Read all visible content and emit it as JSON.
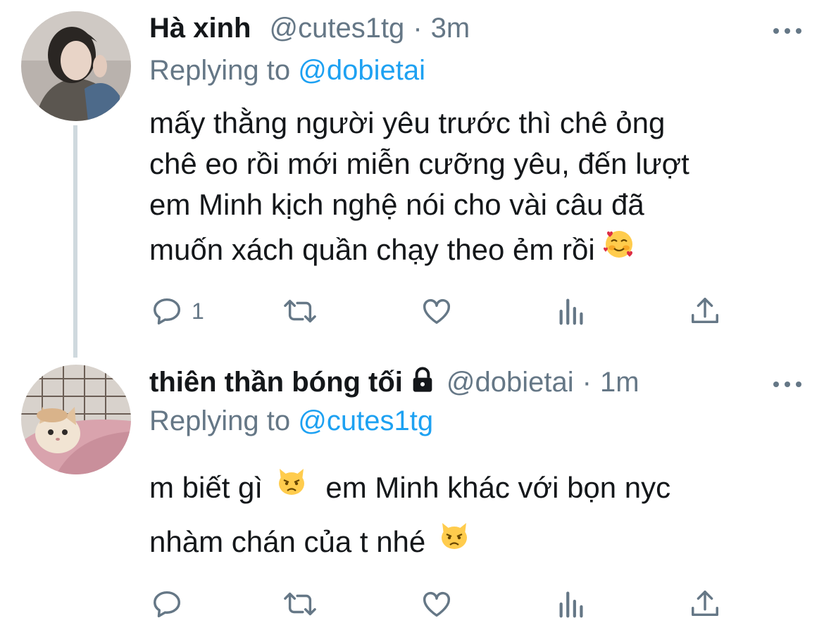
{
  "tweets": [
    {
      "name": "Hà xinh",
      "handle": "@cutes1tg",
      "dot": "·",
      "time": "3m",
      "replying_label": "Replying to",
      "replying_to": "@dobietai",
      "body_lines": [
        "mấy thằng người yêu trước thì chê ỏng",
        "chê eo rồi mới miễn cưỡng yêu, đến lượt",
        "em Minh kịch nghệ nói cho vài câu đã",
        "muốn xách quần chạy theo ẻm rồi"
      ],
      "body_emoji": "smiling-face-with-hearts",
      "reply_count": "1",
      "locked": false,
      "avatar": "person-photo"
    },
    {
      "name": "thiên thần bóng tối",
      "handle": "@dobietai",
      "dot": "·",
      "time": "1m",
      "replying_label": "Replying to",
      "replying_to": "@cutes1tg",
      "body_lines": [
        "m biết gì",
        "em Minh khác với bọn nyc",
        "nhàm chán của t nhé"
      ],
      "body_emoji": "pouting-cat",
      "reply_count": "",
      "locked": true,
      "avatar": "kitten-photo"
    }
  ],
  "colors": {
    "text": "#14171a",
    "secondary": "#657786",
    "link": "#1da1f2",
    "thread_line": "#cfd9de"
  },
  "icons": {
    "reply": "reply-icon",
    "retweet": "retweet-icon",
    "like": "heart-icon",
    "analytics": "analytics-icon",
    "share": "share-icon",
    "more": "more-icon",
    "lock": "lock-icon"
  }
}
